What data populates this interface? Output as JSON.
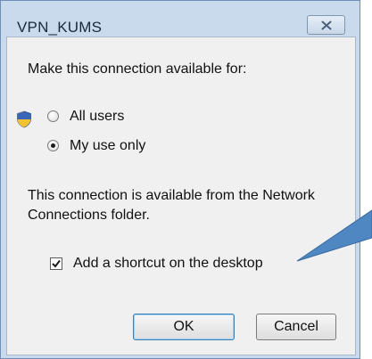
{
  "window": {
    "title": "VPN_KUMS",
    "close_icon": "close-icon"
  },
  "dialog": {
    "availability_label": "Make this connection available for:",
    "options": [
      {
        "label": "All users",
        "selected": false
      },
      {
        "label": "My use only",
        "selected": true
      }
    ],
    "info_text_line1": "This connection is available from the Network",
    "info_text_line2": "Connections folder.",
    "shortcut_label": "Add a shortcut on the desktop",
    "shortcut_checked": true,
    "ok_label": "OK",
    "cancel_label": "Cancel"
  },
  "icons": {
    "shield": "uac-shield-icon"
  },
  "colors": {
    "titlebar": "#c9daec",
    "client": "#f0f0f0",
    "callout": "#4f87c3"
  }
}
